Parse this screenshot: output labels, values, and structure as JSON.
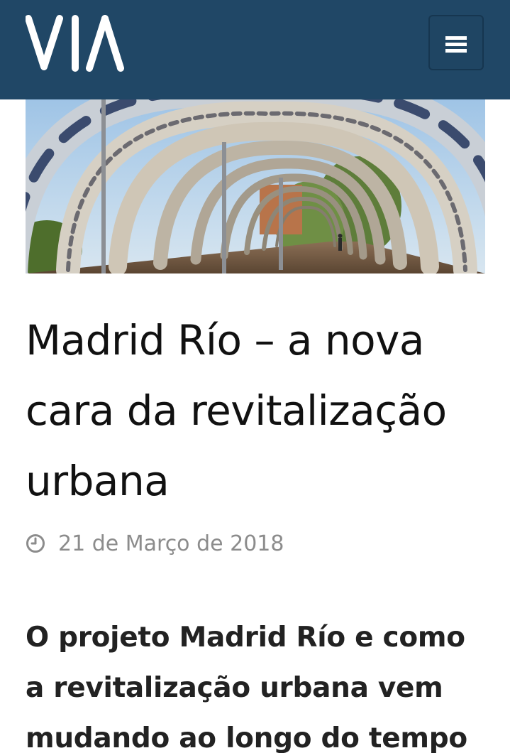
{
  "header": {
    "logo_text": "VIA",
    "background_color": "#204766",
    "menu_icon": "hamburger-icon"
  },
  "hero": {
    "description_icon": "hero-image"
  },
  "article": {
    "title_lines": [
      "Madrid Río – a nova",
      "cara da revitalização",
      "urbana"
    ],
    "date_icon": "clock-icon",
    "date": "21 de Março de 2018",
    "subtitle_lines": [
      "O projeto Madrid Río e como",
      "a revitalização urbana vem",
      "mudando ao longo do tempo"
    ]
  }
}
